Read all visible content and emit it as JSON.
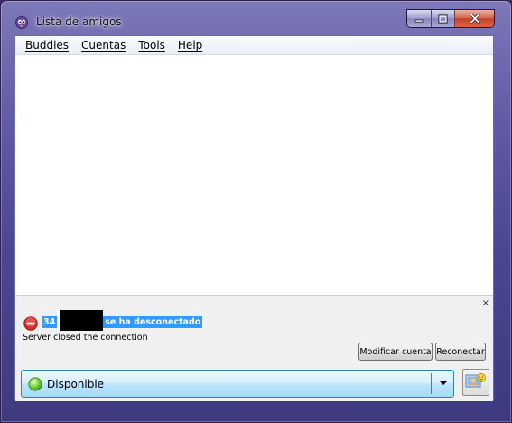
{
  "window": {
    "title": "Lista de amigos",
    "app_icon": "pidgin-icon"
  },
  "menu": {
    "items": [
      {
        "label": "Buddies"
      },
      {
        "label": "Cuentas"
      },
      {
        "label": "Tools"
      },
      {
        "label": "Help"
      }
    ]
  },
  "notice": {
    "close_label": "×",
    "account_prefix": "34",
    "title_suffix": "se ha desconectado",
    "message": "Server closed the connection",
    "icon": "error-icon",
    "modify_label": "Modificar cuenta",
    "reconnect_label": "Reconectar"
  },
  "status": {
    "label": "Disponible",
    "icon": "available-icon",
    "color": "#5bc236"
  },
  "colors": {
    "selection": "#3399ff",
    "window_frame": "#5f5aa4",
    "close_button": "#c3432a"
  }
}
